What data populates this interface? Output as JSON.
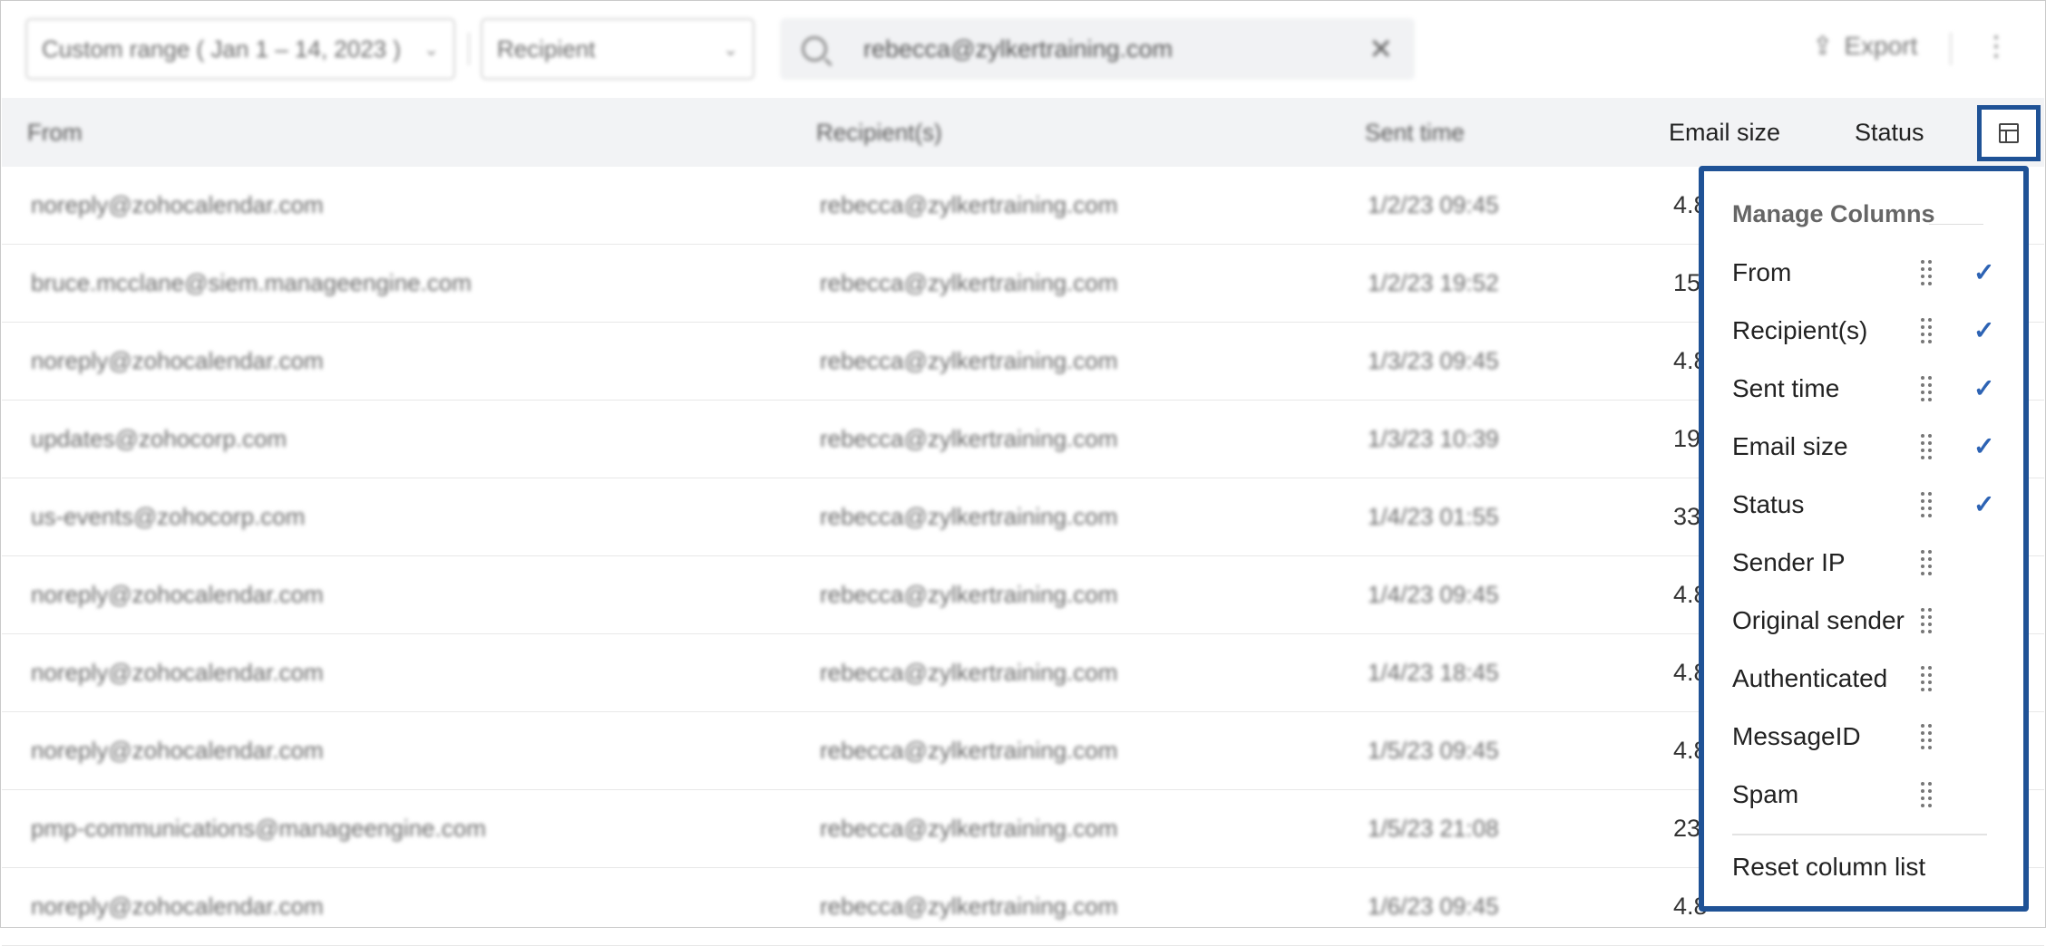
{
  "toolbar": {
    "date_range": "Custom range ( Jan 1 – 14, 2023 )",
    "filter_by": "Recipient",
    "search_value": "rebecca@zylkertraining.com",
    "export_label": "Export"
  },
  "table": {
    "headers": [
      "From",
      "Recipient(s)",
      "Sent time",
      "Email size",
      "Status"
    ],
    "rows": [
      {
        "from": "noreply@zohocalendar.com",
        "recipient": "rebecca@zylkertraining.com",
        "sent": "1/2/23 09:45",
        "size": "4.8"
      },
      {
        "from": "bruce.mcclane@siem.manageengine.com",
        "recipient": "rebecca@zylkertraining.com",
        "sent": "1/2/23 19:52",
        "size": "15"
      },
      {
        "from": "noreply@zohocalendar.com",
        "recipient": "rebecca@zylkertraining.com",
        "sent": "1/3/23 09:45",
        "size": "4.8"
      },
      {
        "from": "updates@zohocorp.com",
        "recipient": "rebecca@zylkertraining.com",
        "sent": "1/3/23 10:39",
        "size": "19"
      },
      {
        "from": "us-events@zohocorp.com",
        "recipient": "rebecca@zylkertraining.com",
        "sent": "1/4/23 01:55",
        "size": "33"
      },
      {
        "from": "noreply@zohocalendar.com",
        "recipient": "rebecca@zylkertraining.com",
        "sent": "1/4/23 09:45",
        "size": "4.8"
      },
      {
        "from": "noreply@zohocalendar.com",
        "recipient": "rebecca@zylkertraining.com",
        "sent": "1/4/23 18:45",
        "size": "4.8"
      },
      {
        "from": "noreply@zohocalendar.com",
        "recipient": "rebecca@zylkertraining.com",
        "sent": "1/5/23 09:45",
        "size": "4.8"
      },
      {
        "from": "pmp-communications@manageengine.com",
        "recipient": "rebecca@zylkertraining.com",
        "sent": "1/5/23 21:08",
        "size": "23"
      },
      {
        "from": "noreply@zohocalendar.com",
        "recipient": "rebecca@zylkertraining.com",
        "sent": "1/6/23 09:45",
        "size": "4.8"
      }
    ]
  },
  "manage_columns": {
    "title": "Manage Columns",
    "items": [
      {
        "label": "From",
        "checked": true
      },
      {
        "label": "Recipient(s)",
        "checked": true
      },
      {
        "label": "Sent time",
        "checked": true
      },
      {
        "label": "Email size",
        "checked": true
      },
      {
        "label": "Status",
        "checked": true
      },
      {
        "label": "Sender IP",
        "checked": false
      },
      {
        "label": "Original sender",
        "checked": false
      },
      {
        "label": "Authenticated",
        "checked": false
      },
      {
        "label": "MessageID",
        "checked": false
      },
      {
        "label": "Spam",
        "checked": false
      }
    ],
    "reset_label": "Reset column list",
    "check_glyph": "✓"
  },
  "icons": {
    "search": "search-icon",
    "clear": "close-icon",
    "export": "export-icon",
    "more": "more-vertical-icon",
    "columns": "columns-icon",
    "drag": "drag-handle-icon",
    "check": "check-icon"
  },
  "colors": {
    "highlight": "#1f5296",
    "check": "#2d63b4"
  }
}
